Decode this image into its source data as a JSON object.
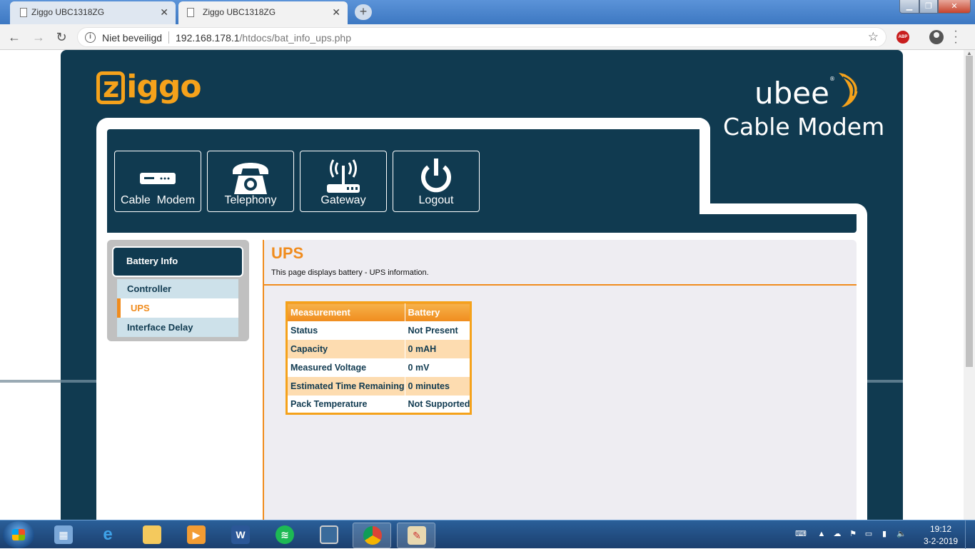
{
  "browser": {
    "tabs": [
      {
        "title": "Ziggo UBC1318ZG",
        "active": false
      },
      {
        "title": "Ziggo UBC1318ZG",
        "active": true
      }
    ],
    "new_tab": "+",
    "security_label": "Niet beveiligd",
    "url_host": "192.168.178.1",
    "url_path": "/htdocs/bat_info_ups.php",
    "abp_label": "ABP"
  },
  "header": {
    "logo_left": "ziggo",
    "logo_right": "ubee",
    "logo_right_mark": "®",
    "subtitle": "Cable Modem"
  },
  "nav": [
    {
      "label": "Cable  Modem",
      "icon": "modem-icon"
    },
    {
      "label": "Telephony",
      "icon": "phone-icon"
    },
    {
      "label": "Gateway",
      "icon": "router-icon"
    },
    {
      "label": "Logout",
      "icon": "power-icon"
    }
  ],
  "menu": {
    "heading": "Battery Info",
    "items": [
      {
        "label": "Controller",
        "active": false
      },
      {
        "label": "UPS",
        "active": true
      },
      {
        "label": "Interface Delay",
        "active": false
      }
    ]
  },
  "content": {
    "title": "UPS",
    "description": "This page displays battery - UPS information.",
    "table": {
      "headers": [
        "Measurement",
        "Battery"
      ],
      "rows": [
        [
          "Status",
          "Not Present"
        ],
        [
          "Capacity",
          "0 mAH"
        ],
        [
          "Measured Voltage",
          "0 mV"
        ],
        [
          "Estimated Time Remaining",
          "0 minutes"
        ],
        [
          "Pack Temperature",
          "Not Supported"
        ]
      ]
    }
  },
  "taskbar": {
    "clock_time": "19:12",
    "clock_date": "3-2-2019",
    "apps": [
      "file-explorer-icon",
      "ie-icon",
      "folder-icon",
      "media-icon",
      "word-icon",
      "spotify-icon",
      "app-icon",
      "chrome-icon",
      "paint-icon"
    ]
  },
  "colors": {
    "brand_dark": "#103a50",
    "brand_orange": "#f08c1e",
    "row_alt": "#fddcb0"
  }
}
